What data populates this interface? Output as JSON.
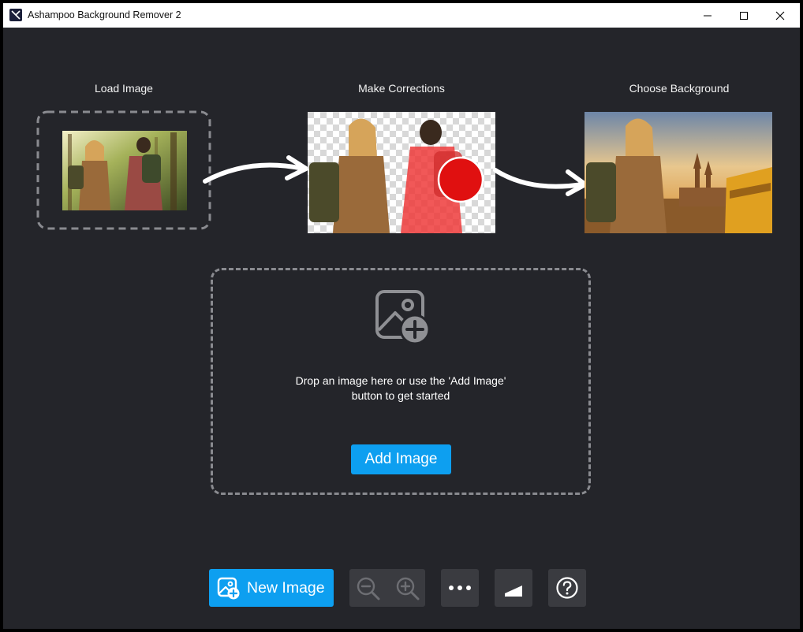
{
  "window": {
    "title": "Ashampoo Background Remover 2"
  },
  "steps": [
    {
      "label": "Load Image"
    },
    {
      "label": "Make Corrections"
    },
    {
      "label": "Choose Background"
    }
  ],
  "dropzone": {
    "text_line1": "Drop an image here or use the 'Add Image'",
    "text_line2": "button to get started",
    "add_button_label": "Add Image"
  },
  "toolbar": {
    "new_image_label": "New Image"
  },
  "colors": {
    "accent": "#0d9ff0",
    "background": "#24252a",
    "toolbar_button": "#3a3b40"
  },
  "icons": {
    "dropzone": "image-add-icon",
    "new_image": "image-add-icon",
    "zoom_out": "zoom-out-icon",
    "zoom_in": "zoom-in-icon",
    "more": "more-dots-icon",
    "compare": "compare-icon",
    "help": "help-icon"
  }
}
